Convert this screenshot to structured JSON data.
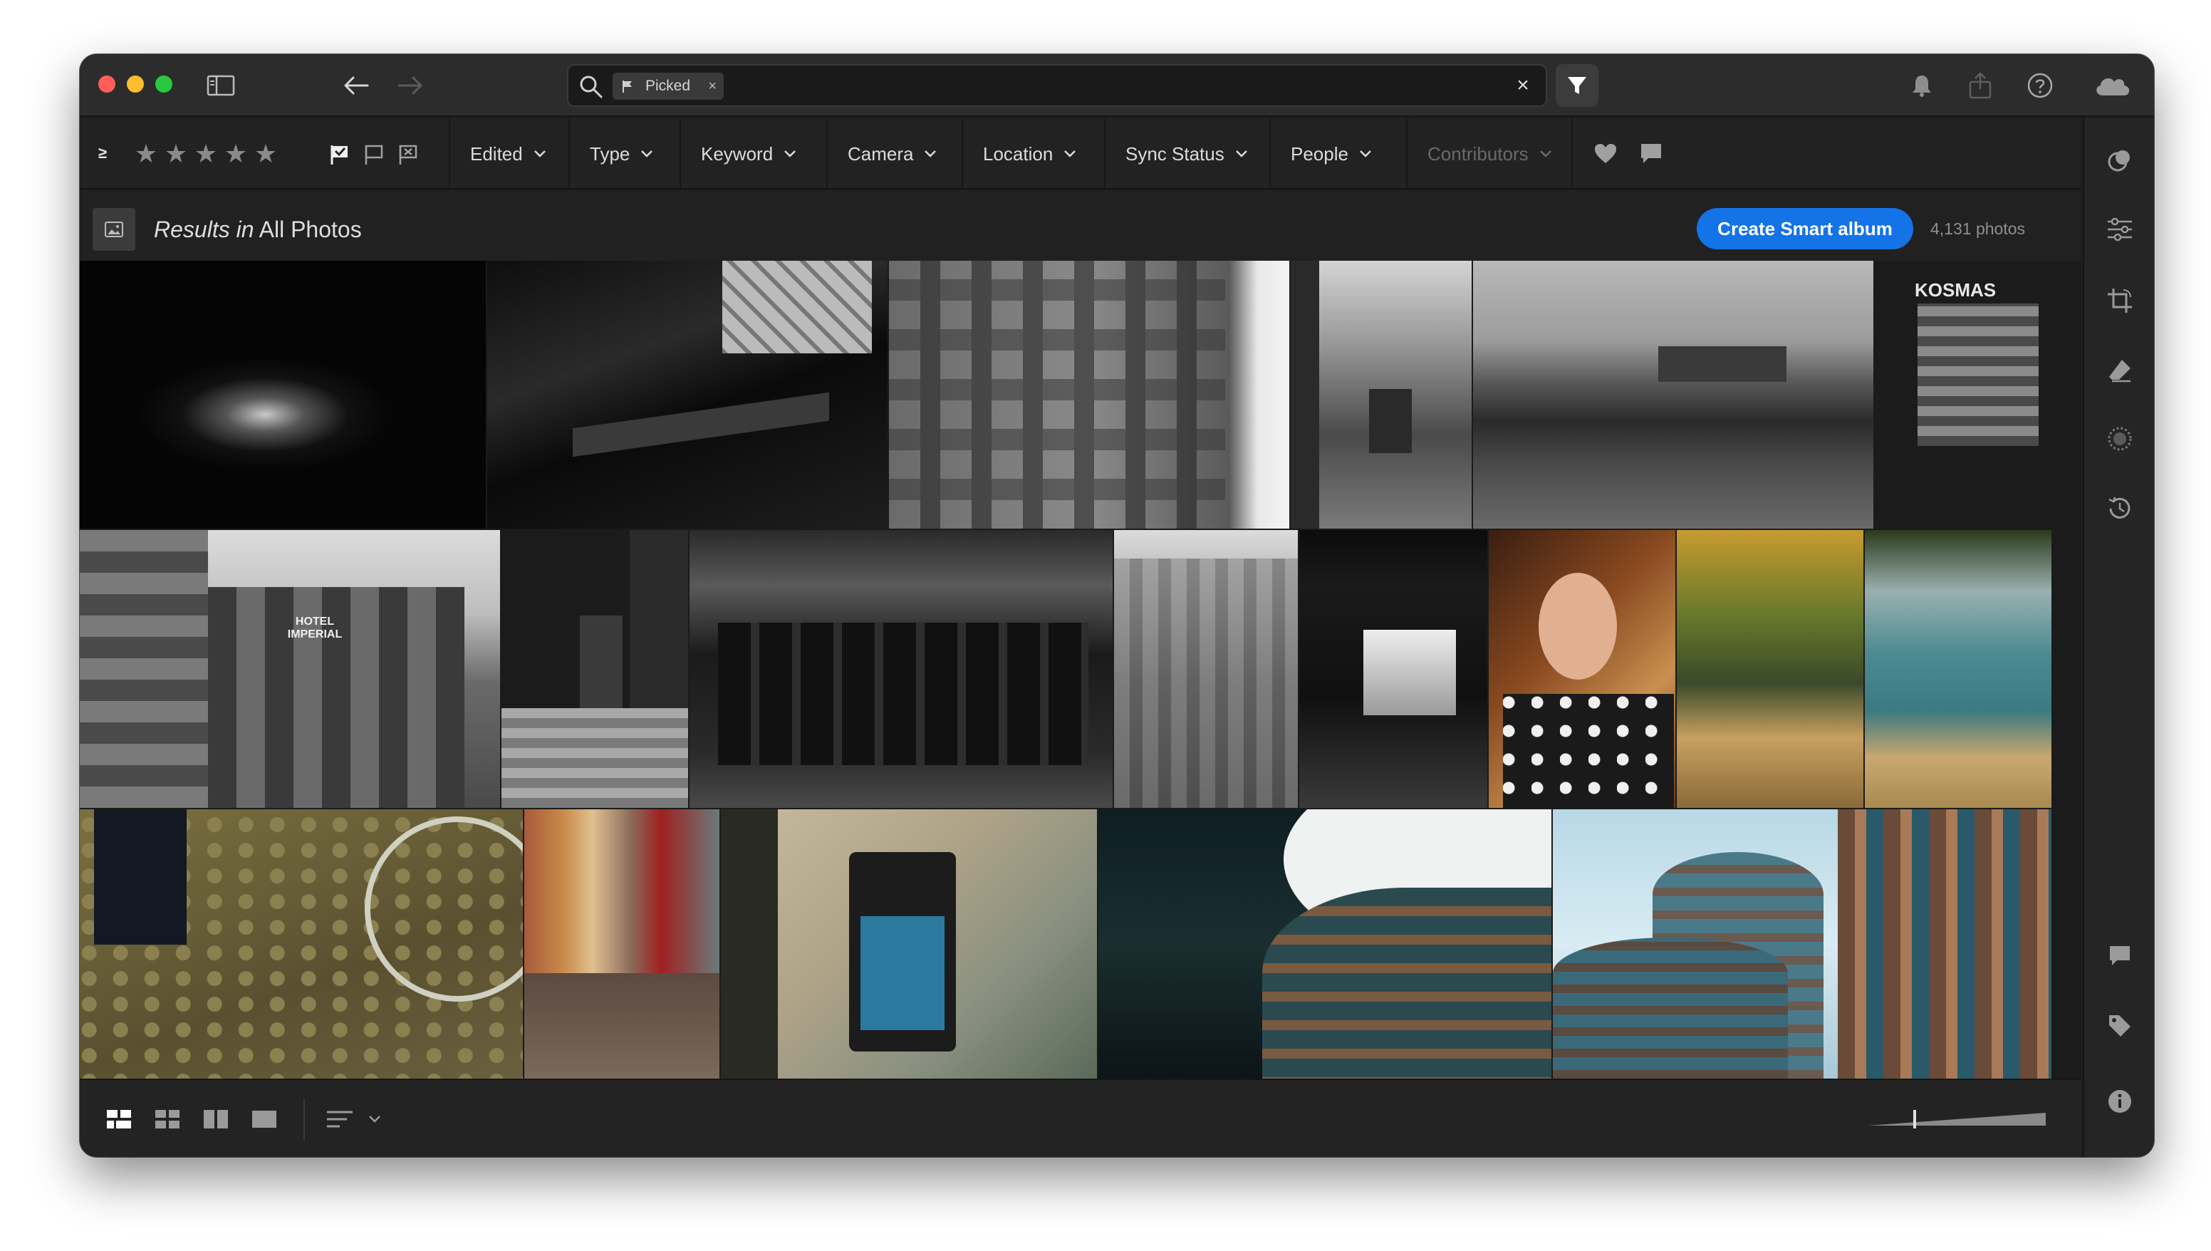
{
  "titlebar": {
    "search_chip_label": "Picked",
    "chip_remove_symbol": "×",
    "clear_symbol": "×"
  },
  "filterbar": {
    "rating_operator": "≥",
    "star_symbol": "★",
    "dropdowns": [
      {
        "label": "Edited",
        "enabled": true
      },
      {
        "label": "Type",
        "enabled": true
      },
      {
        "label": "Keyword",
        "enabled": true
      },
      {
        "label": "Camera",
        "enabled": true
      },
      {
        "label": "Location",
        "enabled": true
      },
      {
        "label": "Sync Status",
        "enabled": true
      },
      {
        "label": "People",
        "enabled": true
      },
      {
        "label": "Contributors",
        "enabled": false
      }
    ]
  },
  "results": {
    "prefix": "Results in",
    "album": "All Photos",
    "create_button": "Create Smart album",
    "count": "4,131 photos"
  },
  "colors": {
    "accent": "#1473e6",
    "traffic_red": "#ff5f57",
    "traffic_yellow": "#febc2e",
    "traffic_green": "#28c840"
  },
  "photos": [
    {
      "name": "night-fire",
      "label": ""
    },
    {
      "name": "cafe-interior",
      "label": ""
    },
    {
      "name": "building-facade",
      "label": ""
    },
    {
      "name": "street-tram",
      "label": ""
    },
    {
      "name": "prague-castle",
      "label": ""
    },
    {
      "name": "kiosk",
      "label": "KOSMAS"
    },
    {
      "name": "hotel-imperial",
      "label": "HOTEL IMPERIAL"
    },
    {
      "name": "statue-steps",
      "label": ""
    },
    {
      "name": "soldiers",
      "label": ""
    },
    {
      "name": "city-street-aerial",
      "label": ""
    },
    {
      "name": "corridor",
      "label": ""
    },
    {
      "name": "portrait-woman",
      "label": ""
    },
    {
      "name": "cyclist-park",
      "label": ""
    },
    {
      "name": "lake-shore",
      "label": ""
    },
    {
      "name": "cobblestones-bike",
      "label": ""
    },
    {
      "name": "colorful-street",
      "label": ""
    },
    {
      "name": "ashtray-wall",
      "label": ""
    },
    {
      "name": "curved-building",
      "label": ""
    },
    {
      "name": "towers-building",
      "label": ""
    }
  ]
}
